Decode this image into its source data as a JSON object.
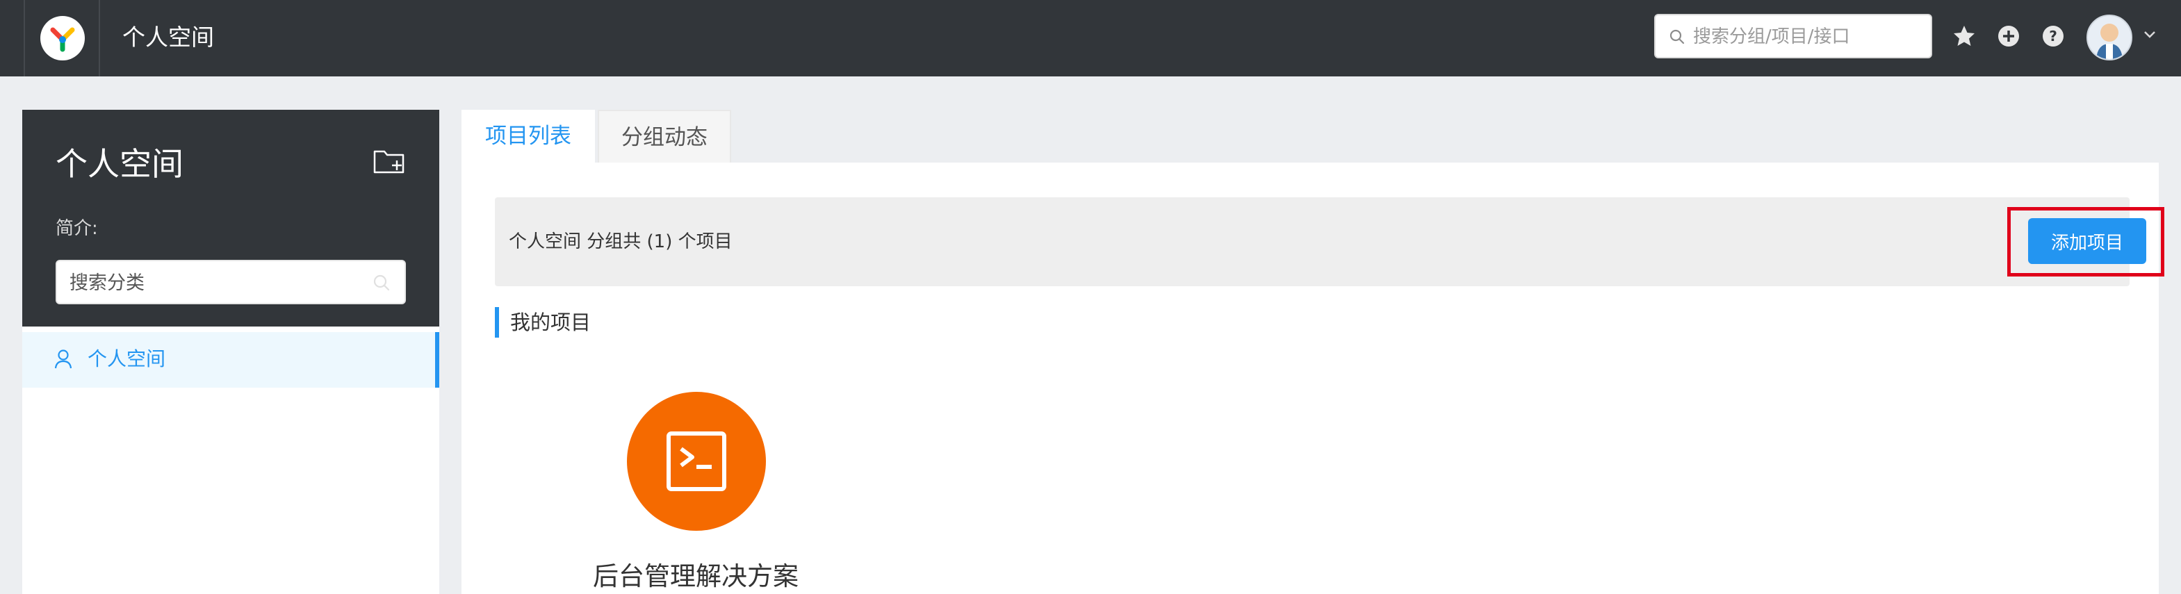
{
  "header": {
    "title": "个人空间",
    "logo_icon": "yapi-logo-icon",
    "search": {
      "placeholder": "搜索分组/项目/接口",
      "value": ""
    },
    "icons": [
      "star-icon",
      "add-circle-icon",
      "help-icon",
      "avatar",
      "chevron-down-icon"
    ]
  },
  "sidebar": {
    "group_name": "个人空间",
    "description_label": "简介:",
    "category_search": {
      "placeholder": "搜索分类",
      "value": ""
    },
    "items": [
      {
        "label": "个人空间",
        "icon": "user-icon",
        "active": true
      }
    ]
  },
  "main": {
    "tabs": [
      {
        "label": "项目列表",
        "active": true
      },
      {
        "label": "分组动态",
        "active": false
      }
    ],
    "summary": "个人空间 分组共 (1) 个项目",
    "add_project_label": "添加项目",
    "section_title": "我的项目",
    "projects": [
      {
        "name": "后台管理解决方案",
        "icon": "terminal-icon",
        "color": "#f56a00"
      }
    ]
  },
  "colors": {
    "header_bg": "#32363a",
    "accent": "#2395f1",
    "highlight": "#e0001a",
    "project_logo": "#f56a00"
  }
}
